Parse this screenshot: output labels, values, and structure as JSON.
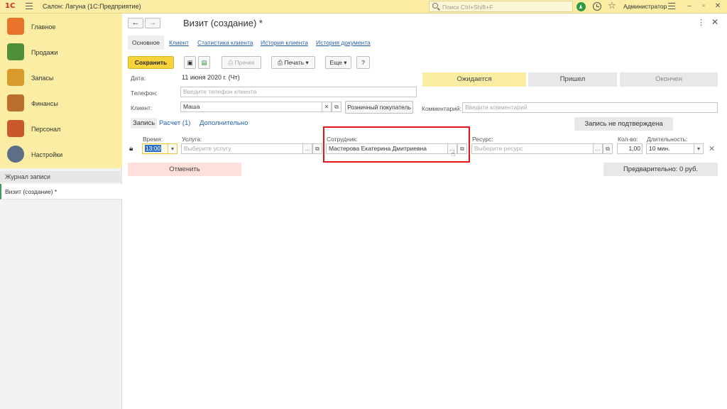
{
  "topbar": {
    "logo": "1С",
    "app_title": "Салон: Лагуна  (1С:Предприятие)",
    "search_placeholder": "Поиск Ctrl+Shift+F",
    "user": "Администратор"
  },
  "sidebar": {
    "items": [
      {
        "label": "Главное",
        "icon": "clipboard-icon",
        "color": "#e8732a"
      },
      {
        "label": "Продажи",
        "icon": "bar-chart-icon",
        "color": "#4f8f3a"
      },
      {
        "label": "Запасы",
        "icon": "boxes-icon",
        "color": "#d99a2b"
      },
      {
        "label": "Финансы",
        "icon": "wallet-icon",
        "color": "#b8702c"
      },
      {
        "label": "Персонал",
        "icon": "people-icon",
        "color": "#c9582a"
      },
      {
        "label": "Настройки",
        "icon": "gear-icon",
        "color": "#5c6f86"
      }
    ],
    "journal_header": "Журнал записи",
    "journal_item": "Визит (создание) *"
  },
  "form": {
    "title": "Визит (создание) *",
    "tabs": [
      "Основное",
      "Клиент",
      "Статистика клиента",
      "История клиента",
      "История документа"
    ],
    "toolbar": {
      "save": "Сохранить",
      "check": "Пречек",
      "print": "Печать",
      "more": "Еще",
      "help": "?"
    },
    "date_label": "Дата:",
    "date_value": "11 июня 2020 г. (Чт)",
    "phone_label": "Телефон:",
    "phone_placeholder": "Введите телефон клиента",
    "client_label": "Клиент:",
    "client_value": "Маша",
    "retail_button": "Розничный покупатель",
    "comment_label": "Комментарий:",
    "comment_placeholder": "Введите комментарий",
    "status": {
      "expected": "Ожидается",
      "arrived": "Пришел",
      "finished": "Окончен"
    },
    "sub_tabs": [
      "Запись",
      "Расчет (1)",
      "Дополнительно"
    ],
    "not_confirmed": "Запись не подтверждена",
    "time_label": "Время:",
    "time_value": "13:00",
    "service_label": "Услуга:",
    "service_placeholder": "Выберите услугу",
    "employee_label": "Сотрудник:",
    "employee_value": "Мастерова Екатерина Дмитриевна",
    "resource_label": "Ресурс:",
    "resource_placeholder": "Выберите ресурс",
    "qty_label": "Кол-во:",
    "qty_value": "1,00",
    "duration_label": "Длительность:",
    "duration_value": "10 мин.",
    "cancel": "Отменить",
    "preliminary": "Предварительно: 0 руб.",
    "highlight_color": "#e3121b"
  }
}
